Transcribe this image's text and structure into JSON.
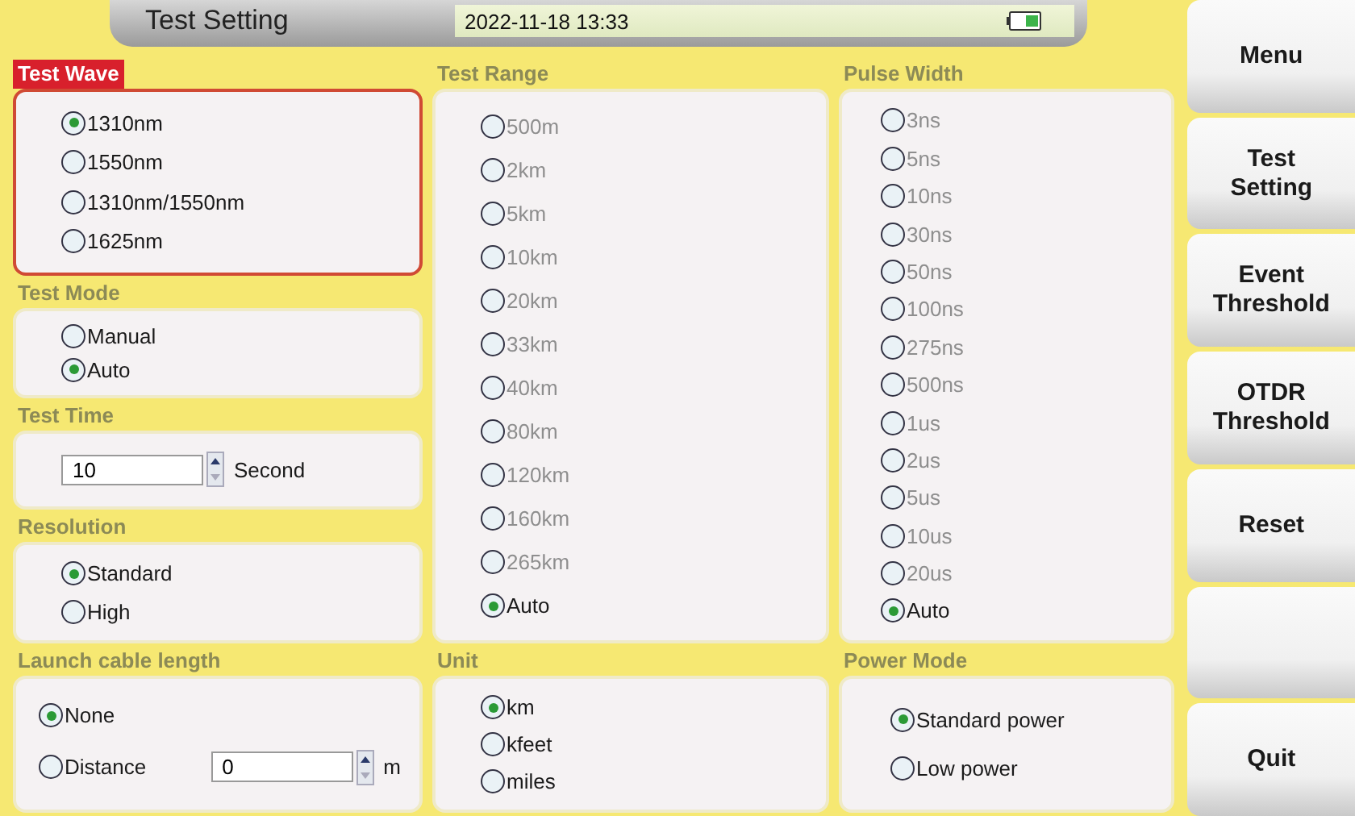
{
  "header": {
    "title": "Test Setting",
    "datetime": "2022-11-18 13:33"
  },
  "columns": [
    {
      "upper": [
        {
          "title": "Test Wave",
          "focused": true,
          "items": [
            {
              "kind": "radio",
              "label": "1310nm",
              "selected": true,
              "disabled": false
            },
            {
              "kind": "radio",
              "label": "1550nm",
              "selected": false,
              "disabled": false
            },
            {
              "kind": "radio",
              "label": "1310nm/1550nm",
              "selected": false,
              "disabled": false
            },
            {
              "kind": "radio",
              "label": "1625nm",
              "selected": false,
              "disabled": false
            }
          ]
        },
        {
          "title": "Test Mode",
          "focused": false,
          "items": [
            {
              "kind": "radio",
              "label": "Manual",
              "selected": false,
              "disabled": false
            },
            {
              "kind": "radio",
              "label": "Auto",
              "selected": true,
              "disabled": false
            }
          ]
        },
        {
          "title": "Test Time",
          "focused": false,
          "items": [
            {
              "kind": "number",
              "value": "10",
              "unit": "Second"
            }
          ]
        },
        {
          "title": "Resolution",
          "focused": false,
          "items": [
            {
              "kind": "radio",
              "label": "Standard",
              "selected": true,
              "disabled": false
            },
            {
              "kind": "radio",
              "label": "High",
              "selected": false,
              "disabled": false
            }
          ]
        }
      ],
      "lower": {
        "title": "Launch cable length",
        "focused": false,
        "items": [
          {
            "kind": "radio",
            "label": "None",
            "selected": true,
            "disabled": false
          },
          {
            "kind": "radio",
            "label": "Distance",
            "selected": false,
            "disabled": false,
            "field": {
              "value": "0",
              "unit": "m"
            }
          }
        ]
      }
    },
    {
      "upper": [
        {
          "title": "Test Range",
          "focused": false,
          "items": [
            {
              "kind": "radio",
              "label": "500m",
              "selected": false,
              "disabled": true
            },
            {
              "kind": "radio",
              "label": "2km",
              "selected": false,
              "disabled": true
            },
            {
              "kind": "radio",
              "label": "5km",
              "selected": false,
              "disabled": true
            },
            {
              "kind": "radio",
              "label": "10km",
              "selected": false,
              "disabled": true
            },
            {
              "kind": "radio",
              "label": "20km",
              "selected": false,
              "disabled": true
            },
            {
              "kind": "radio",
              "label": "33km",
              "selected": false,
              "disabled": true
            },
            {
              "kind": "radio",
              "label": "40km",
              "selected": false,
              "disabled": true
            },
            {
              "kind": "radio",
              "label": "80km",
              "selected": false,
              "disabled": true
            },
            {
              "kind": "radio",
              "label": "120km",
              "selected": false,
              "disabled": true
            },
            {
              "kind": "radio",
              "label": "160km",
              "selected": false,
              "disabled": true
            },
            {
              "kind": "radio",
              "label": "265km",
              "selected": false,
              "disabled": true
            },
            {
              "kind": "radio",
              "label": "Auto",
              "selected": true,
              "disabled": false
            }
          ]
        }
      ],
      "lower": {
        "title": "Unit",
        "focused": false,
        "items": [
          {
            "kind": "radio",
            "label": "km",
            "selected": true,
            "disabled": false
          },
          {
            "kind": "radio",
            "label": "kfeet",
            "selected": false,
            "disabled": false
          },
          {
            "kind": "radio",
            "label": "miles",
            "selected": false,
            "disabled": false
          }
        ]
      }
    },
    {
      "upper": [
        {
          "title": "Pulse Width",
          "focused": false,
          "items": [
            {
              "kind": "radio",
              "label": "3ns",
              "selected": false,
              "disabled": true
            },
            {
              "kind": "radio",
              "label": "5ns",
              "selected": false,
              "disabled": true
            },
            {
              "kind": "radio",
              "label": "10ns",
              "selected": false,
              "disabled": true
            },
            {
              "kind": "radio",
              "label": "30ns",
              "selected": false,
              "disabled": true
            },
            {
              "kind": "radio",
              "label": "50ns",
              "selected": false,
              "disabled": true
            },
            {
              "kind": "radio",
              "label": "100ns",
              "selected": false,
              "disabled": true
            },
            {
              "kind": "radio",
              "label": "275ns",
              "selected": false,
              "disabled": true
            },
            {
              "kind": "radio",
              "label": "500ns",
              "selected": false,
              "disabled": true
            },
            {
              "kind": "radio",
              "label": "1us",
              "selected": false,
              "disabled": true
            },
            {
              "kind": "radio",
              "label": "2us",
              "selected": false,
              "disabled": true
            },
            {
              "kind": "radio",
              "label": "5us",
              "selected": false,
              "disabled": true
            },
            {
              "kind": "radio",
              "label": "10us",
              "selected": false,
              "disabled": true
            },
            {
              "kind": "radio",
              "label": "20us",
              "selected": false,
              "disabled": true
            },
            {
              "kind": "radio",
              "label": "Auto",
              "selected": true,
              "disabled": false
            }
          ]
        }
      ],
      "lower": {
        "title": "Power Mode",
        "focused": false,
        "items": [
          {
            "kind": "radio",
            "label": "Standard power",
            "selected": true,
            "disabled": false
          },
          {
            "kind": "radio",
            "label": "Low power",
            "selected": false,
            "disabled": false
          }
        ]
      }
    }
  ],
  "side_menu": [
    {
      "kind": "button",
      "label": "Menu"
    },
    {
      "kind": "button",
      "label": "Test Setting"
    },
    {
      "kind": "button",
      "label": "Event Threshold"
    },
    {
      "kind": "button",
      "label": "OTDR Threshold"
    },
    {
      "kind": "button",
      "label": "Reset"
    },
    {
      "kind": "blank"
    },
    {
      "kind": "button",
      "label": "Quit"
    }
  ]
}
